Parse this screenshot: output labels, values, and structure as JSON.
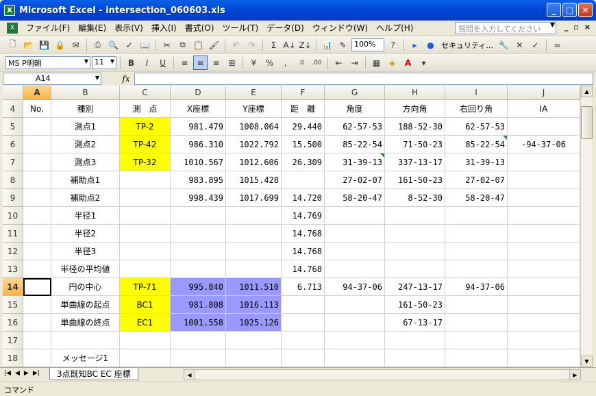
{
  "window": {
    "title": "Microsoft Excel - intersection_060603.xls",
    "app_icon": "excel-icon"
  },
  "menu": {
    "items": [
      "ファイル(F)",
      "編集(E)",
      "表示(V)",
      "挿入(I)",
      "書式(O)",
      "ツール(T)",
      "データ(D)",
      "ウィンドウ(W)",
      "ヘルプ(H)"
    ],
    "help_placeholder": "質問を入力してください"
  },
  "toolbar": {
    "zoom": "100%",
    "security_label": "セキュリティ...",
    "font_name": "MS P明朝",
    "font_size": "11"
  },
  "formula_bar": {
    "name_box": "A14",
    "fx": "fx",
    "formula": ""
  },
  "sheet": {
    "columns": [
      "A",
      "B",
      "C",
      "D",
      "E",
      "F",
      "G",
      "H",
      "I",
      "J"
    ],
    "selected_cell": "A14",
    "rows": [
      {
        "num": "4",
        "cells": [
          "No.",
          "種別",
          "測　点",
          "X座標",
          "Y座標",
          "距　離",
          "角度",
          "方向角",
          "右回り角",
          "IA"
        ]
      },
      {
        "num": "5",
        "cells": [
          "",
          "測点1",
          "TP-2",
          "981.479",
          "1008.064",
          "29.440",
          "62-57-53",
          "188-52-30",
          "62-57-53",
          ""
        ]
      },
      {
        "num": "6",
        "cells": [
          "",
          "測点2",
          "TP-42",
          "986.310",
          "1022.792",
          "15.500",
          "85-22-54",
          "71-50-23",
          "85-22-54",
          "-94-37-06"
        ]
      },
      {
        "num": "7",
        "cells": [
          "",
          "測点3",
          "TP-32",
          "1010.567",
          "1012.606",
          "26.309",
          "31-39-13",
          "337-13-17",
          "31-39-13",
          ""
        ]
      },
      {
        "num": "8",
        "cells": [
          "",
          "補助点1",
          "",
          "983.895",
          "1015.428",
          "",
          "27-02-07",
          "161-50-23",
          "27-02-07",
          ""
        ]
      },
      {
        "num": "9",
        "cells": [
          "",
          "補助点2",
          "",
          "998.439",
          "1017.699",
          "14.720",
          "58-20-47",
          "8-52-30",
          "58-20-47",
          ""
        ]
      },
      {
        "num": "10",
        "cells": [
          "",
          "半径1",
          "",
          "",
          "",
          "14.769",
          "",
          "",
          "",
          ""
        ]
      },
      {
        "num": "11",
        "cells": [
          "",
          "半径2",
          "",
          "",
          "",
          "14.768",
          "",
          "",
          "",
          ""
        ]
      },
      {
        "num": "12",
        "cells": [
          "",
          "半径3",
          "",
          "",
          "",
          "14.768",
          "",
          "",
          "",
          ""
        ]
      },
      {
        "num": "13",
        "cells": [
          "",
          "半径の平均値",
          "",
          "",
          "",
          "14.768",
          "",
          "",
          "",
          ""
        ]
      },
      {
        "num": "14",
        "cells": [
          "",
          "円の中心",
          "TP-71",
          "995.840",
          "1011.510",
          "6.713",
          "94-37-06",
          "247-13-17",
          "94-37-06",
          ""
        ]
      },
      {
        "num": "15",
        "cells": [
          "",
          "単曲線の起点",
          "BC1",
          "981.808",
          "1016.113",
          "",
          "",
          "161-50-23",
          "",
          ""
        ]
      },
      {
        "num": "16",
        "cells": [
          "",
          "単曲線の終点",
          "EC1",
          "1001.558",
          "1025.126",
          "",
          "",
          "67-13-17",
          "",
          ""
        ]
      },
      {
        "num": "17",
        "cells": [
          "",
          "",
          "",
          "",
          "",
          "",
          "",
          "",
          "",
          ""
        ]
      },
      {
        "num": "18",
        "cells": [
          "",
          "メッセージ1",
          "",
          "",
          "",
          "",
          "",
          "",
          "",
          ""
        ]
      }
    ],
    "colors": {
      "yellow_fill": "#ffff00",
      "blue_fill": "#9999ff",
      "comment_marker": "#2e8b2e"
    }
  },
  "tabs": {
    "sheet_name": "3点既知BC EC 座標"
  },
  "status": {
    "text": "コマンド"
  }
}
